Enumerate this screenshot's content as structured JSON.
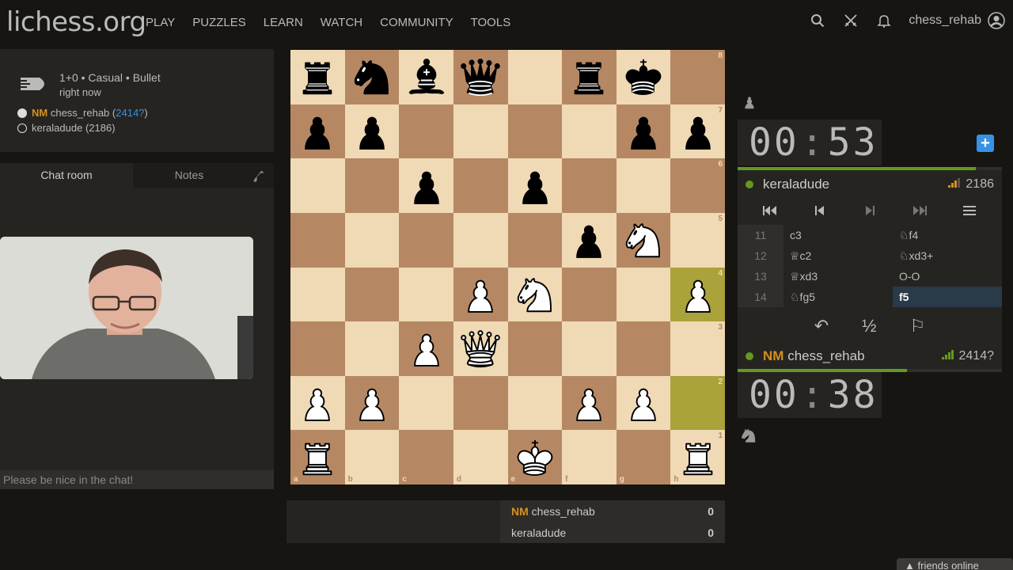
{
  "header": {
    "logo": "lichess.org",
    "nav": [
      "PLAY",
      "PUZZLES",
      "LEARN",
      "WATCH",
      "COMMUNITY",
      "TOOLS"
    ],
    "username": "chess_rehab",
    "icons": [
      "search-icon",
      "swords-icon",
      "bell-icon",
      "user-icon"
    ]
  },
  "game_info": {
    "line1": "1+0 • Casual • Bullet",
    "line2": "right now",
    "white": {
      "title": "NM",
      "name": "chess_rehab",
      "rating_open": " (",
      "rating": "2414?",
      "rating_close": ")"
    },
    "black": {
      "name": "keraladude (2186)"
    }
  },
  "chat": {
    "tabs": [
      "Chat room",
      "Notes"
    ],
    "placeholder": "Please be nice in the chat!"
  },
  "board": {
    "ranks": [
      "8",
      "7",
      "6",
      "5",
      "4",
      "3",
      "2",
      "1"
    ],
    "files": [
      "a",
      "b",
      "c",
      "d",
      "e",
      "f",
      "g",
      "h"
    ],
    "position": [
      [
        "bR",
        "bN",
        "bB",
        "bQ",
        "",
        "bR",
        "bK",
        ""
      ],
      [
        "bP",
        "bP",
        "",
        "",
        "",
        "",
        "bP",
        "bP"
      ],
      [
        "",
        "",
        "bP",
        "",
        "bP",
        "",
        "",
        ""
      ],
      [
        "",
        "",
        "",
        "",
        "",
        "bP",
        "wN",
        ""
      ],
      [
        "",
        "",
        "",
        "wP",
        "wN",
        "",
        "",
        "wP"
      ],
      [
        "",
        "",
        "wP",
        "wQ",
        "",
        "",
        "",
        ""
      ],
      [
        "wP",
        "wP",
        "",
        "",
        "",
        "wP",
        "wP",
        ""
      ],
      [
        "wR",
        "",
        "",
        "",
        "wK",
        "",
        "",
        "wR"
      ]
    ],
    "last_move": [
      "h2",
      "h4"
    ],
    "colors": {
      "light": "#f0d9b5",
      "dark": "#b58863",
      "highlight": "#aaa23a"
    }
  },
  "crosstable": {
    "rows": [
      {
        "title": "NM",
        "name": "chess_rehab",
        "score": "0"
      },
      {
        "title": "",
        "name": "keraladude",
        "score": "0"
      }
    ]
  },
  "clocks": {
    "top": {
      "minutes": "00",
      "seconds": "53",
      "time_remaining_fraction": 0.9
    },
    "bottom": {
      "minutes": "00",
      "seconds": "38",
      "time_remaining_fraction": 0.64
    }
  },
  "players_panel": {
    "top": {
      "title": "",
      "name": "keraladude",
      "rating": "2186"
    },
    "bottom": {
      "title": "NM",
      "name": "chess_rehab",
      "rating": "2414?"
    }
  },
  "moves": [
    {
      "num": "11",
      "white": "c3",
      "black": "♘f4"
    },
    {
      "num": "12",
      "white": "♕c2",
      "black": "♘xd3+"
    },
    {
      "num": "13",
      "white": "♕xd3",
      "black": "O-O"
    },
    {
      "num": "14",
      "white": "♘fg5",
      "black": "f5"
    }
  ],
  "actions": {
    "takeback": "↶",
    "draw": "½",
    "resign": "⚐"
  },
  "friends": "friends online",
  "accent_colors": {
    "green": "#629924",
    "blue": "#3692e7",
    "title": "#d59020"
  }
}
